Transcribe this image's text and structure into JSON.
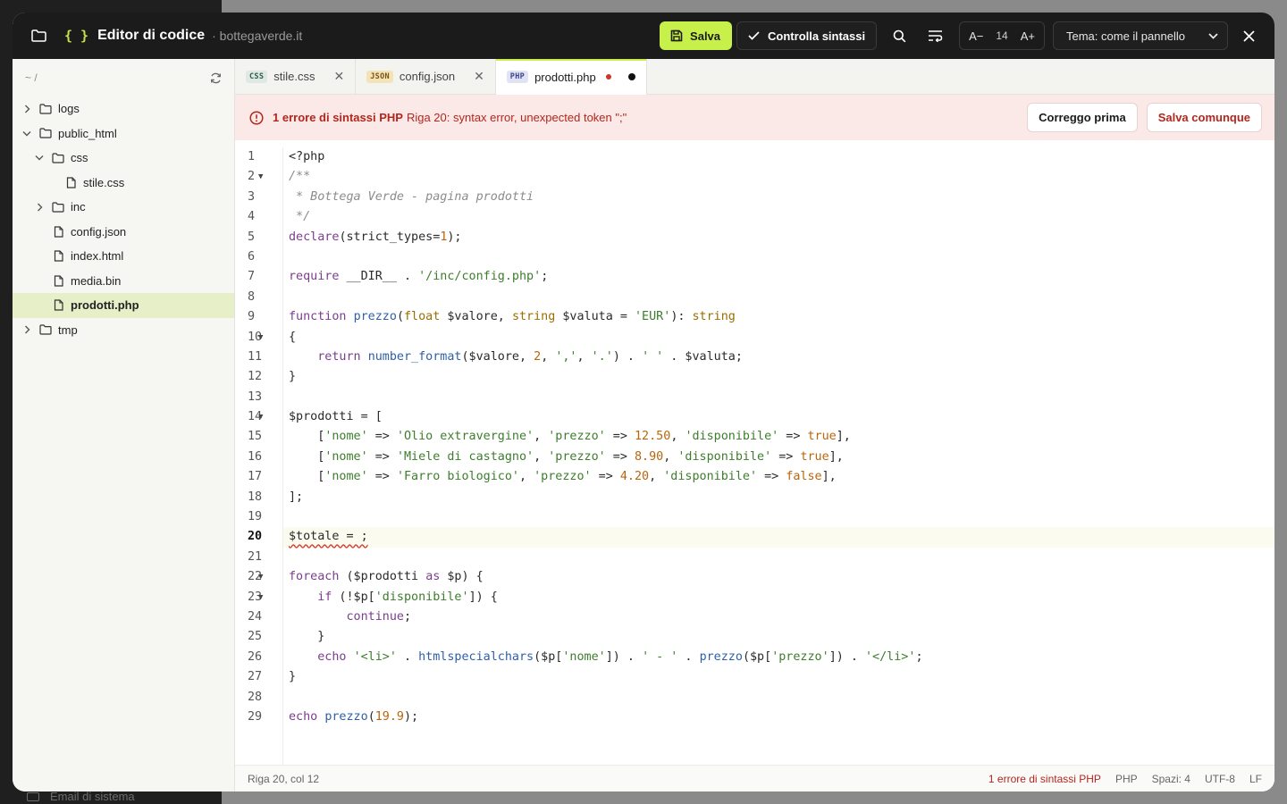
{
  "header": {
    "title": "Editor di codice",
    "domain": "· bottegaverde.it",
    "save_label": "Salva",
    "check_label": "Controlla sintassi",
    "font_decrease": "A−",
    "font_size": "14",
    "font_increase": "A+",
    "theme_value": "Tema: come il pannello"
  },
  "sidebar": {
    "path": "~ /",
    "tree": [
      {
        "label": "logs",
        "type": "folder",
        "depth": 0,
        "expanded": false
      },
      {
        "label": "public_html",
        "type": "folder",
        "depth": 0,
        "expanded": true
      },
      {
        "label": "css",
        "type": "folder",
        "depth": 1,
        "expanded": true
      },
      {
        "label": "stile.css",
        "type": "file",
        "depth": 2
      },
      {
        "label": "inc",
        "type": "folder",
        "depth": 1,
        "expanded": false
      },
      {
        "label": "config.json",
        "type": "file",
        "depth": 1
      },
      {
        "label": "index.html",
        "type": "file",
        "depth": 1
      },
      {
        "label": "media.bin",
        "type": "file",
        "depth": 1
      },
      {
        "label": "prodotti.php",
        "type": "file",
        "depth": 1,
        "active": true
      },
      {
        "label": "tmp",
        "type": "folder",
        "depth": 0,
        "expanded": false
      }
    ]
  },
  "tabs": [
    {
      "badge": "CSS",
      "label": "stile.css"
    },
    {
      "badge": "JSON",
      "label": "config.json"
    },
    {
      "badge": "PHP",
      "label": "prodotti.php"
    }
  ],
  "error_bar": {
    "title": "1 errore di sintassi PHP",
    "message": "Riga 20: syntax error, unexpected token \";\"",
    "fix_label": "Correggo prima",
    "force_label": "Salva comunque"
  },
  "code": {
    "lines": [
      "1",
      "2",
      "3",
      "4",
      "5",
      "6",
      "7",
      "8",
      "9",
      "10",
      "11",
      "12",
      "13",
      "14",
      "15",
      "16",
      "17",
      "18",
      "19",
      "20",
      "21",
      "22",
      "23",
      "24",
      "25",
      "26",
      "27",
      "28",
      "29"
    ]
  },
  "status": {
    "position": "Riga 20, col 12",
    "errors": "1 errore di sintassi PHP",
    "language": "PHP",
    "indent": "Spazi: 4",
    "encoding": "UTF-8",
    "eol": "LF"
  },
  "backdrop": {
    "email": "Email di sistema"
  }
}
